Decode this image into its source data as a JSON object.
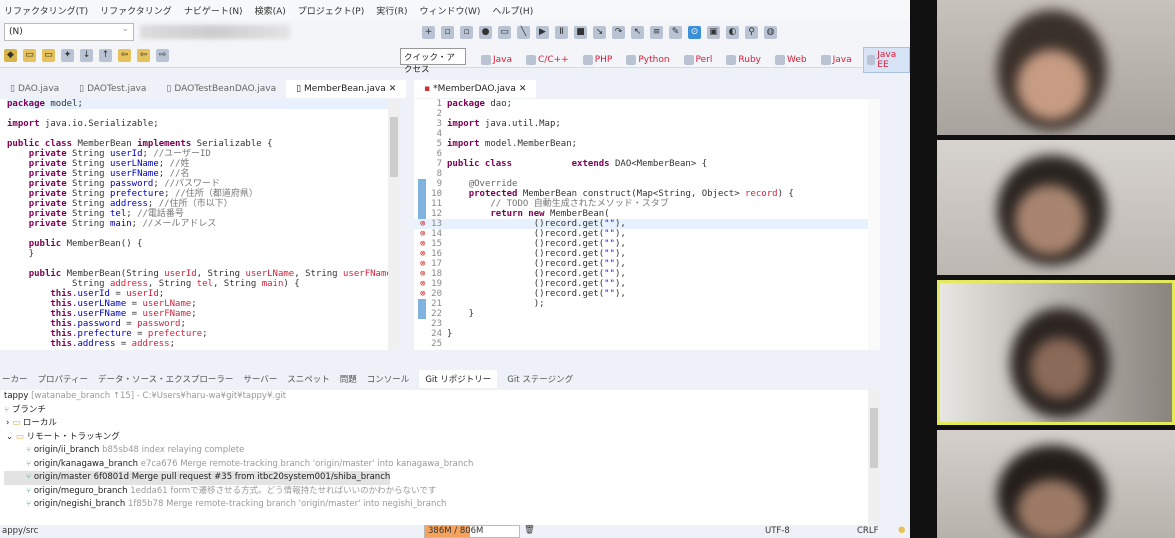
{
  "menu": [
    "リファクタリング(T)",
    "リファクタリング",
    "ナビゲート(N)",
    "検索(A)",
    "プロジェクト(P)",
    "実行(R)",
    "ウィンドウ(W)",
    "ヘルプ(H)"
  ],
  "toolbar": {
    "combo_value": "(N)",
    "quick_access": "クイック・アクセス"
  },
  "perspectives": [
    {
      "label": "Java",
      "selected": false
    },
    {
      "label": "C/C++",
      "selected": false
    },
    {
      "label": "PHP",
      "selected": false
    },
    {
      "label": "Python",
      "selected": false
    },
    {
      "label": "Perl",
      "selected": false
    },
    {
      "label": "Ruby",
      "selected": false
    },
    {
      "label": "Web",
      "selected": false
    },
    {
      "label": "Java",
      "selected": false
    },
    {
      "label": "Java EE",
      "selected": true
    }
  ],
  "left_tabs": [
    "DAO.java",
    "DAOTest.java",
    "DAOTestBeanDAO.java",
    "MemberBean.java"
  ],
  "right_tab": "*MemberDAO.java",
  "left_code": [
    [
      [
        "k",
        "package"
      ],
      [
        "e",
        " model;"
      ]
    ],
    [],
    [
      [
        "k",
        "import"
      ],
      [
        "e",
        " java.io.Serializable;"
      ]
    ],
    [],
    [
      [
        "k",
        "public class"
      ],
      [
        "e",
        " MemberBean "
      ],
      [
        "k",
        "implements"
      ],
      [
        "e",
        " Serializable {"
      ]
    ],
    [
      [
        "e",
        "    "
      ],
      [
        "k",
        "private"
      ],
      [
        "e",
        " String "
      ],
      [
        "f",
        "userId"
      ],
      [
        "e",
        "; "
      ],
      [
        "c",
        "//ユーザーID"
      ]
    ],
    [
      [
        "e",
        "    "
      ],
      [
        "k",
        "private"
      ],
      [
        "e",
        " String "
      ],
      [
        "f",
        "userLName"
      ],
      [
        "e",
        "; "
      ],
      [
        "c",
        "//姓"
      ]
    ],
    [
      [
        "e",
        "    "
      ],
      [
        "k",
        "private"
      ],
      [
        "e",
        " String "
      ],
      [
        "f",
        "userFName"
      ],
      [
        "e",
        "; "
      ],
      [
        "c",
        "//名"
      ]
    ],
    [
      [
        "e",
        "    "
      ],
      [
        "k",
        "private"
      ],
      [
        "e",
        " String "
      ],
      [
        "f",
        "password"
      ],
      [
        "e",
        "; "
      ],
      [
        "c",
        "//パスワード"
      ]
    ],
    [
      [
        "e",
        "    "
      ],
      [
        "k",
        "private"
      ],
      [
        "e",
        " String "
      ],
      [
        "f",
        "prefecture"
      ],
      [
        "e",
        "; "
      ],
      [
        "c",
        "//住所（都道府県）"
      ]
    ],
    [
      [
        "e",
        "    "
      ],
      [
        "k",
        "private"
      ],
      [
        "e",
        " String "
      ],
      [
        "f",
        "address"
      ],
      [
        "e",
        "; "
      ],
      [
        "c",
        "//住所（市以下）"
      ]
    ],
    [
      [
        "e",
        "    "
      ],
      [
        "k",
        "private"
      ],
      [
        "e",
        " String "
      ],
      [
        "f",
        "tel"
      ],
      [
        "e",
        "; "
      ],
      [
        "c",
        "//電話番号"
      ]
    ],
    [
      [
        "e",
        "    "
      ],
      [
        "k",
        "private"
      ],
      [
        "e",
        " String "
      ],
      [
        "f",
        "main"
      ],
      [
        "e",
        "; "
      ],
      [
        "c",
        "//メールアドレス"
      ]
    ],
    [],
    [
      [
        "e",
        "    "
      ],
      [
        "k",
        "public"
      ],
      [
        "e",
        " MemberBean() {"
      ]
    ],
    [
      [
        "e",
        "    }"
      ]
    ],
    [],
    [
      [
        "e",
        "    "
      ],
      [
        "k",
        "public"
      ],
      [
        "e",
        " MemberBean(String "
      ],
      [
        "p",
        "userId"
      ],
      [
        "e",
        ", String "
      ],
      [
        "p",
        "userLName"
      ],
      [
        "e",
        ", String "
      ],
      [
        "p",
        "userFName"
      ]
    ],
    [
      [
        "e",
        "            String "
      ],
      [
        "p",
        "address"
      ],
      [
        "e",
        ", String "
      ],
      [
        "p",
        "tel"
      ],
      [
        "e",
        ", String "
      ],
      [
        "p",
        "main"
      ],
      [
        "e",
        ") {"
      ]
    ],
    [
      [
        "e",
        "        "
      ],
      [
        "k",
        "this"
      ],
      [
        "e",
        "."
      ],
      [
        "f",
        "userId"
      ],
      [
        "e",
        " = "
      ],
      [
        "p",
        "userId"
      ],
      [
        "e",
        ";"
      ]
    ],
    [
      [
        "e",
        "        "
      ],
      [
        "k",
        "this"
      ],
      [
        "e",
        "."
      ],
      [
        "f",
        "userLName"
      ],
      [
        "e",
        " = "
      ],
      [
        "p",
        "userLName"
      ],
      [
        "e",
        ";"
      ]
    ],
    [
      [
        "e",
        "        "
      ],
      [
        "k",
        "this"
      ],
      [
        "e",
        "."
      ],
      [
        "f",
        "userFName"
      ],
      [
        "e",
        " = "
      ],
      [
        "p",
        "userFName"
      ],
      [
        "e",
        ";"
      ]
    ],
    [
      [
        "e",
        "        "
      ],
      [
        "k",
        "this"
      ],
      [
        "e",
        "."
      ],
      [
        "f",
        "password"
      ],
      [
        "e",
        " = "
      ],
      [
        "p",
        "password"
      ],
      [
        "e",
        ";"
      ]
    ],
    [
      [
        "e",
        "        "
      ],
      [
        "k",
        "this"
      ],
      [
        "e",
        "."
      ],
      [
        "f",
        "prefecture"
      ],
      [
        "e",
        " = "
      ],
      [
        "p",
        "prefecture"
      ],
      [
        "e",
        ";"
      ]
    ],
    [
      [
        "e",
        "        "
      ],
      [
        "k",
        "this"
      ],
      [
        "e",
        "."
      ],
      [
        "f",
        "address"
      ],
      [
        "e",
        " = "
      ],
      [
        "p",
        "address"
      ],
      [
        "e",
        ";"
      ]
    ]
  ],
  "right_code": [
    [
      [
        "k",
        "package"
      ],
      [
        "e",
        " dao;"
      ]
    ],
    [],
    [
      [
        "k",
        "import"
      ],
      [
        "e",
        " java.util.Map;"
      ]
    ],
    [],
    [
      [
        "k",
        "import"
      ],
      [
        "e",
        " model.MemberBean;"
      ]
    ],
    [],
    [
      [
        "k",
        "public class"
      ],
      [
        "e",
        "           "
      ],
      [
        "k",
        "extends"
      ],
      [
        "e",
        " DAO<MemberBean> {"
      ]
    ],
    [],
    [
      [
        "e",
        "    "
      ],
      [
        "a",
        "@Override"
      ]
    ],
    [
      [
        "e",
        "    "
      ],
      [
        "k",
        "protected"
      ],
      [
        "e",
        " MemberBean construct(Map<String, Object> "
      ],
      [
        "p",
        "record"
      ],
      [
        "e",
        ") {"
      ]
    ],
    [
      [
        "e",
        "        "
      ],
      [
        "c",
        "// TODO 自動生成されたメソッド・スタブ"
      ]
    ],
    [
      [
        "e",
        "        "
      ],
      [
        "k",
        "return new"
      ],
      [
        "e",
        " MemberBean("
      ]
    ],
    [
      [
        "e",
        "                ()record.get("
      ],
      [
        "s",
        "\"\""
      ],
      [
        "e",
        "),"
      ]
    ],
    [
      [
        "e",
        "                ()record.get("
      ],
      [
        "s",
        "\"\""
      ],
      [
        "e",
        "),"
      ]
    ],
    [
      [
        "e",
        "                ()record.get("
      ],
      [
        "s",
        "\"\""
      ],
      [
        "e",
        "),"
      ]
    ],
    [
      [
        "e",
        "                ()record.get("
      ],
      [
        "s",
        "\"\""
      ],
      [
        "e",
        "),"
      ]
    ],
    [
      [
        "e",
        "                ()record.get("
      ],
      [
        "s",
        "\"\""
      ],
      [
        "e",
        "),"
      ]
    ],
    [
      [
        "e",
        "                ()record.get("
      ],
      [
        "s",
        "\"\""
      ],
      [
        "e",
        "),"
      ]
    ],
    [
      [
        "e",
        "                ()record.get("
      ],
      [
        "s",
        "\"\""
      ],
      [
        "e",
        "),"
      ]
    ],
    [
      [
        "e",
        "                ()record.get("
      ],
      [
        "s",
        "\"\""
      ],
      [
        "e",
        "),"
      ]
    ],
    [
      [
        "e",
        "                );"
      ]
    ],
    [
      [
        "e",
        "    }"
      ]
    ],
    [],
    [
      [
        "e",
        "}"
      ]
    ],
    []
  ],
  "panel_tabs": [
    "ーカー",
    "プロパティー",
    "データ・ソース・エクスプローラー",
    "サーバー",
    "スニペット",
    "問題",
    "コンソール",
    "Git リポジトリー",
    "Git ステージング"
  ],
  "repo": {
    "name": "tappy",
    "branch": "[watanabe_branch ↑15]",
    "path": "- C:¥Users¥haru-wa¥git¥tappy¥.git"
  },
  "tree": {
    "branches": "ブランチ",
    "local": "ローカル",
    "remote": "リモート・トラッキング",
    "items": [
      {
        "name": "origin/ii_branch",
        "hash": "b85sb48",
        "msg": "index relaying complete"
      },
      {
        "name": "origin/kanagawa_branch",
        "hash": "e7ca676",
        "msg": "Merge remote-tracking branch 'origin/master' into kanagawa_branch"
      },
      {
        "name": "origin/master",
        "hash": "6f0801d",
        "msg": "Merge pull request #35 from itbc20system001/shiba_branch",
        "selected": true
      },
      {
        "name": "origin/meguro_branch",
        "hash": "1edda61",
        "msg": "formで遷移させる方式。どう情報持たせればいいのかわからないです"
      },
      {
        "name": "origin/negishi_branch",
        "hash": "1f85b78",
        "msg": "Merge remote-tracking branch 'origin/master' into negishi_branch"
      }
    ]
  },
  "status": {
    "path": "appy/src",
    "heap": "386M / 806M",
    "heap_used_fraction": 0.48,
    "encoding": "UTF-8",
    "line_ending": "CRLF"
  },
  "colors": {
    "accent": "#f5a35c",
    "active_speaker": "#e4ea5a"
  }
}
